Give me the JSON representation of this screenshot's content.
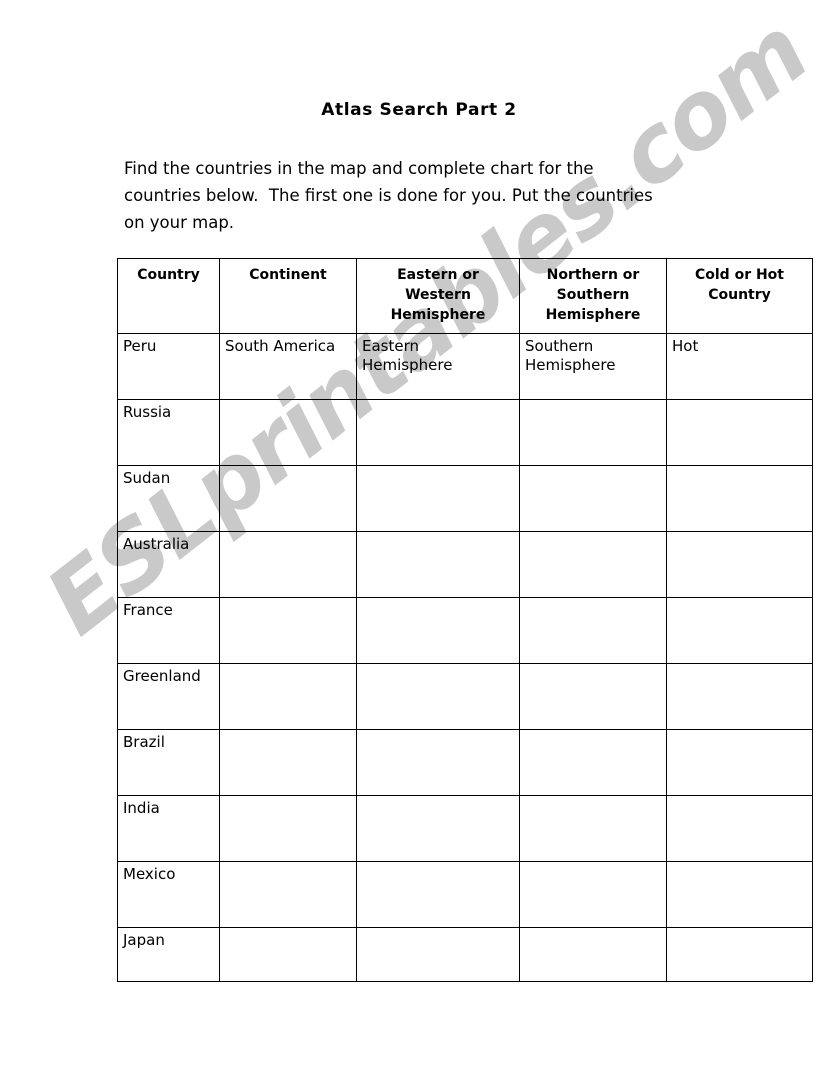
{
  "document": {
    "title": "Atlas Search Part 2",
    "instructions": [
      "Find the countries in the map and complete chart for the",
      "countries below.  The first one is done for you. Put the countries",
      "on your map."
    ],
    "watermark": "ESLprintables.com"
  },
  "chart_data": {
    "type": "table",
    "title": "Atlas Search Part 2",
    "columns": [
      {
        "id": "country",
        "label": "Country",
        "label_lines": [
          "Country"
        ]
      },
      {
        "id": "continent",
        "label": "Continent",
        "label_lines": [
          "Continent"
        ]
      },
      {
        "id": "ew_hemisphere",
        "label": "Eastern or Western Hemisphere",
        "label_lines": [
          "Eastern or",
          "Western",
          "Hemisphere"
        ]
      },
      {
        "id": "ns_hemisphere",
        "label": "Northern or Southern Hemisphere",
        "label_lines": [
          "Northern or",
          "Southern",
          "Hemisphere"
        ]
      },
      {
        "id": "climate",
        "label": "Cold or Hot Country",
        "label_lines": [
          "Cold or Hot",
          "Country"
        ]
      }
    ],
    "rows": [
      {
        "country": "Peru",
        "continent": "South America",
        "ew_hemisphere_lines": [
          "Eastern",
          "Hemisphere"
        ],
        "ns_hemisphere_lines": [
          "Southern",
          "Hemisphere"
        ],
        "climate": "Hot"
      },
      {
        "country": "Russia",
        "continent": "",
        "ew_hemisphere_lines": [],
        "ns_hemisphere_lines": [],
        "climate": ""
      },
      {
        "country": "Sudan",
        "continent": "",
        "ew_hemisphere_lines": [],
        "ns_hemisphere_lines": [],
        "climate": ""
      },
      {
        "country": "Australia",
        "continent": "",
        "ew_hemisphere_lines": [],
        "ns_hemisphere_lines": [],
        "climate": ""
      },
      {
        "country": "France",
        "continent": "",
        "ew_hemisphere_lines": [],
        "ns_hemisphere_lines": [],
        "climate": ""
      },
      {
        "country": "Greenland",
        "continent": "",
        "ew_hemisphere_lines": [],
        "ns_hemisphere_lines": [],
        "climate": ""
      },
      {
        "country": "Brazil",
        "continent": "",
        "ew_hemisphere_lines": [],
        "ns_hemisphere_lines": [],
        "climate": ""
      },
      {
        "country": "India",
        "continent": "",
        "ew_hemisphere_lines": [],
        "ns_hemisphere_lines": [],
        "climate": ""
      },
      {
        "country": "Mexico",
        "continent": "",
        "ew_hemisphere_lines": [],
        "ns_hemisphere_lines": [],
        "climate": ""
      },
      {
        "country": "Japan",
        "continent": "",
        "ew_hemisphere_lines": [],
        "ns_hemisphere_lines": [],
        "climate": ""
      }
    ],
    "colors": {
      "border": "#000000",
      "text": "#000000",
      "background": "#ffffff",
      "watermark": "#c9c9c9"
    }
  }
}
